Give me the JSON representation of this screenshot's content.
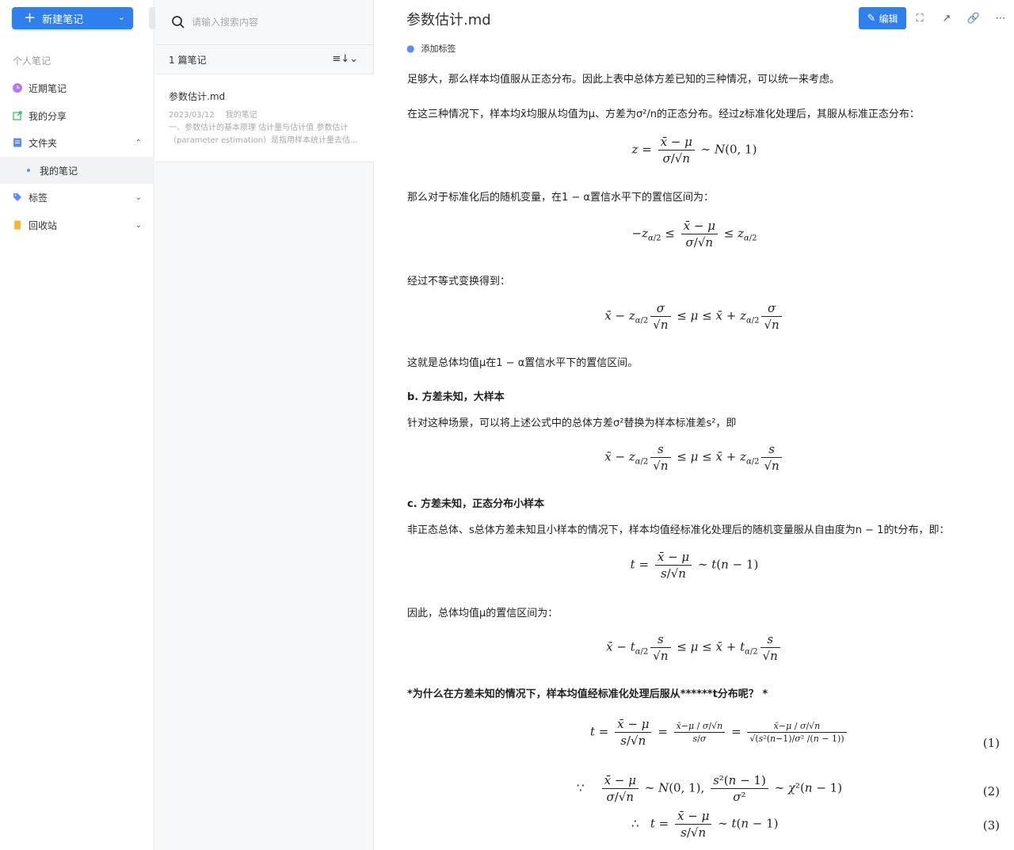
{
  "sidebar": {
    "new_note": "新建笔记",
    "section_title": "个人笔记",
    "items": [
      {
        "label": "近期笔记"
      },
      {
        "label": "我的分享"
      },
      {
        "label": "文件夹"
      },
      {
        "label": "我的笔记"
      },
      {
        "label": "标签"
      },
      {
        "label": "回收站"
      }
    ]
  },
  "list": {
    "search_placeholder": "请输入搜索内容",
    "count": "1 篇笔记",
    "note": {
      "title": "参数估计.md",
      "date": "2023/03/12",
      "folder": "我的笔记",
      "excerpt": "一、参数估计的基本原理 估计量与估计值 参数估计（parameter estimation）是指用样本统计量去估..."
    }
  },
  "doc": {
    "title": "参数估计.md",
    "edit": "编辑",
    "add_tag": "添加标签",
    "p1": "足够大，那么样本均值服从正态分布。因此上表中总体方差已知的三种情况，可以统一来考虑。",
    "p2": "在这三种情况下，样本均x̄均服从均值为μ、方差为σ²/n的正态分布。经过z标准化处理后，其服从标准正态分布：",
    "p3": "那么对于标准化后的随机变量，在1 − α置信水平下的置信区间为：",
    "p4": "经过不等式变换得到：",
    "p5": "这就是总体均值μ在1 − α置信水平下的置信区间。",
    "h_b": "b. 方差未知，大样本",
    "p6": "针对这种场景，可以将上述公式中的总体方差σ²替换为样本标准差s²，即",
    "h_c": "c. 方差未知，正态分布小样本",
    "p7": "非正态总体、s总体方差未知且小样本的情况下，样本均值经标准化处理后的随机变量服从自由度为n − 1的t分布，即：",
    "p8": "因此，总体均值μ的置信区间为：",
    "h_q": "*为什么在方差未知的情况下，样本均值经标准化处理后服从******t分布呢？ *",
    "eq_nums": [
      "(1)",
      "(2)",
      "(3)"
    ]
  },
  "colors": {
    "accent": "#2f80ed"
  }
}
